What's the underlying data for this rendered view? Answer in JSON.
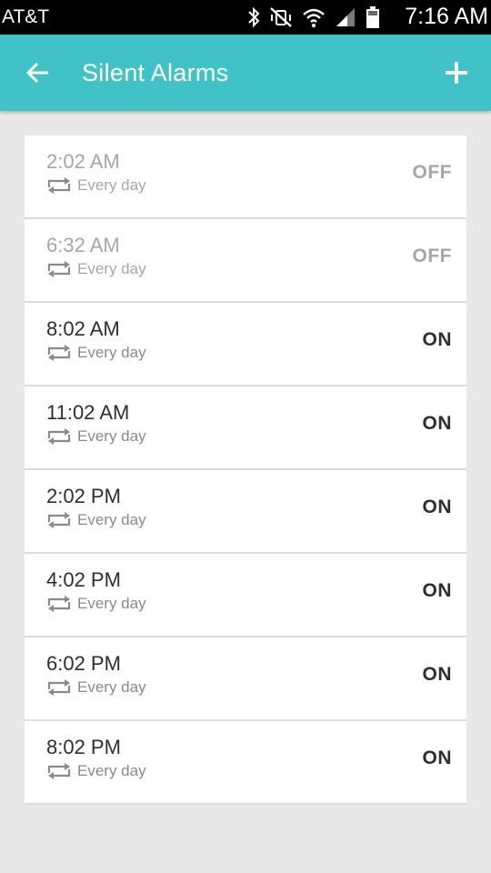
{
  "status_bar": {
    "carrier": "AT&T",
    "time": "7:16 AM",
    "icons": [
      "bluetooth-icon",
      "vibrate-mute-icon",
      "wifi-icon",
      "signal-icon",
      "battery-icon"
    ]
  },
  "app_bar": {
    "title": "Silent Alarms",
    "back_icon": "arrow-left-icon",
    "add_icon": "plus-icon",
    "color": "#40c2c6"
  },
  "alarms": [
    {
      "time": "2:02 AM",
      "repeat": "Every day",
      "state": "OFF"
    },
    {
      "time": "6:32 AM",
      "repeat": "Every day",
      "state": "OFF"
    },
    {
      "time": "8:02 AM",
      "repeat": "Every day",
      "state": "ON"
    },
    {
      "time": "11:02 AM",
      "repeat": "Every day",
      "state": "ON"
    },
    {
      "time": "2:02 PM",
      "repeat": "Every day",
      "state": "ON"
    },
    {
      "time": "4:02 PM",
      "repeat": "Every day",
      "state": "ON"
    },
    {
      "time": "6:02 PM",
      "repeat": "Every day",
      "state": "ON"
    },
    {
      "time": "8:02 PM",
      "repeat": "Every day",
      "state": "ON"
    }
  ],
  "colors": {
    "on_text": "#2e2e2e",
    "off_text": "#a6a6a6",
    "background": "#e8e8e8"
  }
}
